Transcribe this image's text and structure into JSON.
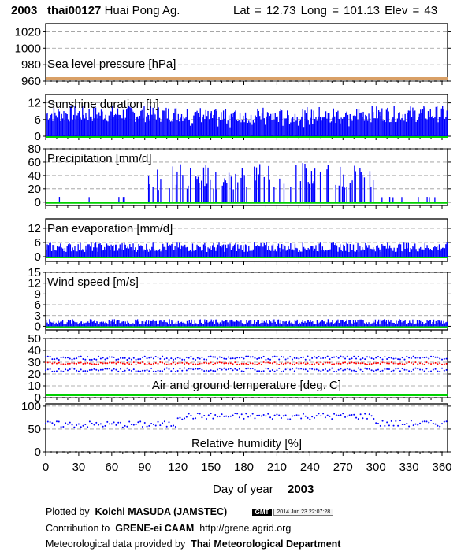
{
  "header": {
    "year": "2003",
    "station_id": "thai00127",
    "station_name": "Huai Pong Ag.",
    "location": "Lat = 12.73   Long = 101.13   Elev = 43"
  },
  "x_axis": {
    "label": "Day of year",
    "year": "2003",
    "ticks": [
      "0",
      "30",
      "60",
      "90",
      "120",
      "150",
      "180",
      "210",
      "240",
      "270",
      "300",
      "330",
      "360"
    ],
    "range": [
      0,
      365
    ]
  },
  "footer": {
    "plotted_prefix": "Plotted by",
    "plotted_name": "Koichi MASUDA (JAMSTEC)",
    "gmt_logo": "GMT",
    "timestamp": "2014 Jun 23 22:07:28",
    "contrib_prefix": "Contribution to",
    "contrib_name": "GRENE-ei CAAM",
    "contrib_url": "http://grene.agrid.org",
    "met_prefix": "Meteorological data provided by",
    "met_name": "Thai Meteorological Department"
  },
  "colors": {
    "bars": "#0000ff",
    "missing": "#00d000",
    "max_temp": "#0000ff",
    "mean_temp": "#ff0000",
    "pressure": "#d9a066",
    "grid": "#999999"
  },
  "chart_data": [
    {
      "type": "line",
      "title": "Sea level pressure [hPa]",
      "yticks": [
        "960",
        "980",
        "1000",
        "1020"
      ],
      "ylim": [
        960,
        1030
      ],
      "series": [
        {
          "values": []
        }
      ],
      "note": "no data; missing markers along bottom"
    },
    {
      "type": "bar",
      "title": "Sunshine duration [h]",
      "yticks": [
        "0",
        "6",
        "12"
      ],
      "ylim": [
        0,
        15
      ]
    },
    {
      "type": "bar",
      "title": "Precipitation [mm/d]",
      "yticks": [
        "0",
        "20",
        "40",
        "60",
        "80"
      ],
      "ylim": [
        -5,
        80
      ]
    },
    {
      "type": "bar",
      "title": "Pan evaporation [mm/d]",
      "yticks": [
        "0",
        "6",
        "12"
      ],
      "ylim": [
        -2,
        16
      ]
    },
    {
      "type": "bar",
      "title": "Wind speed [m/s]",
      "yticks": [
        "0",
        "3",
        "6",
        "9",
        "12",
        "15"
      ],
      "ylim": [
        -1,
        15
      ]
    },
    {
      "type": "scatter",
      "title": "Air and ground temperature [deg. C]",
      "yticks": [
        "0",
        "10",
        "20",
        "30",
        "40",
        "50"
      ],
      "ylim": [
        0,
        50
      ]
    },
    {
      "type": "scatter",
      "title": "Relative humidity [%]",
      "yticks": [
        "0",
        "50",
        "100"
      ],
      "ylim": [
        0,
        105
      ]
    }
  ]
}
